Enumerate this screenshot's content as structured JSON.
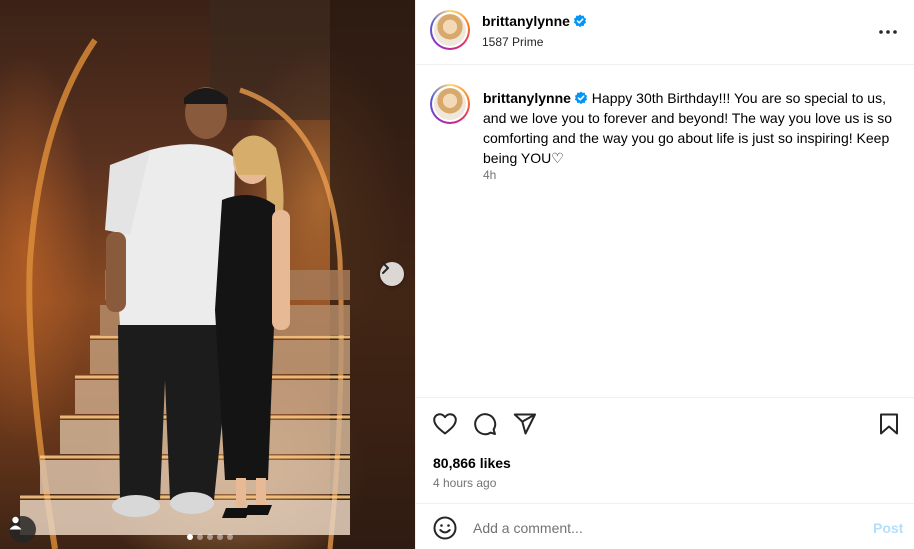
{
  "post": {
    "username": "brittanylynne",
    "subtitle": "1587 Prime",
    "caption_user": "brittanylynne",
    "caption_text": "Happy 30th Birthday!!! You are so special to us, and we love you to forever and beyond! The way you love us is so comforting and the way you go about life is just so inspiring! Keep being YOU♡",
    "caption_time": "4h",
    "likes": "80,866 likes",
    "posted_ago": "4 hours ago"
  },
  "photo": {
    "carousel_total": 5,
    "carousel_active": 1
  },
  "comment": {
    "placeholder": "Add a comment...",
    "post_label": "Post"
  },
  "icons": {
    "verified": "verified-badge-icon",
    "more": "more-options-icon",
    "like": "heart-icon",
    "comment": "comment-icon",
    "share": "share-icon",
    "save": "bookmark-icon",
    "emoji": "emoji-icon",
    "next": "chevron-right-icon",
    "user_tag": "user-tag-icon"
  },
  "colors": {
    "verified_blue": "#0095f6",
    "post_button_disabled": "#b2dffc",
    "secondary_text": "#737373"
  }
}
